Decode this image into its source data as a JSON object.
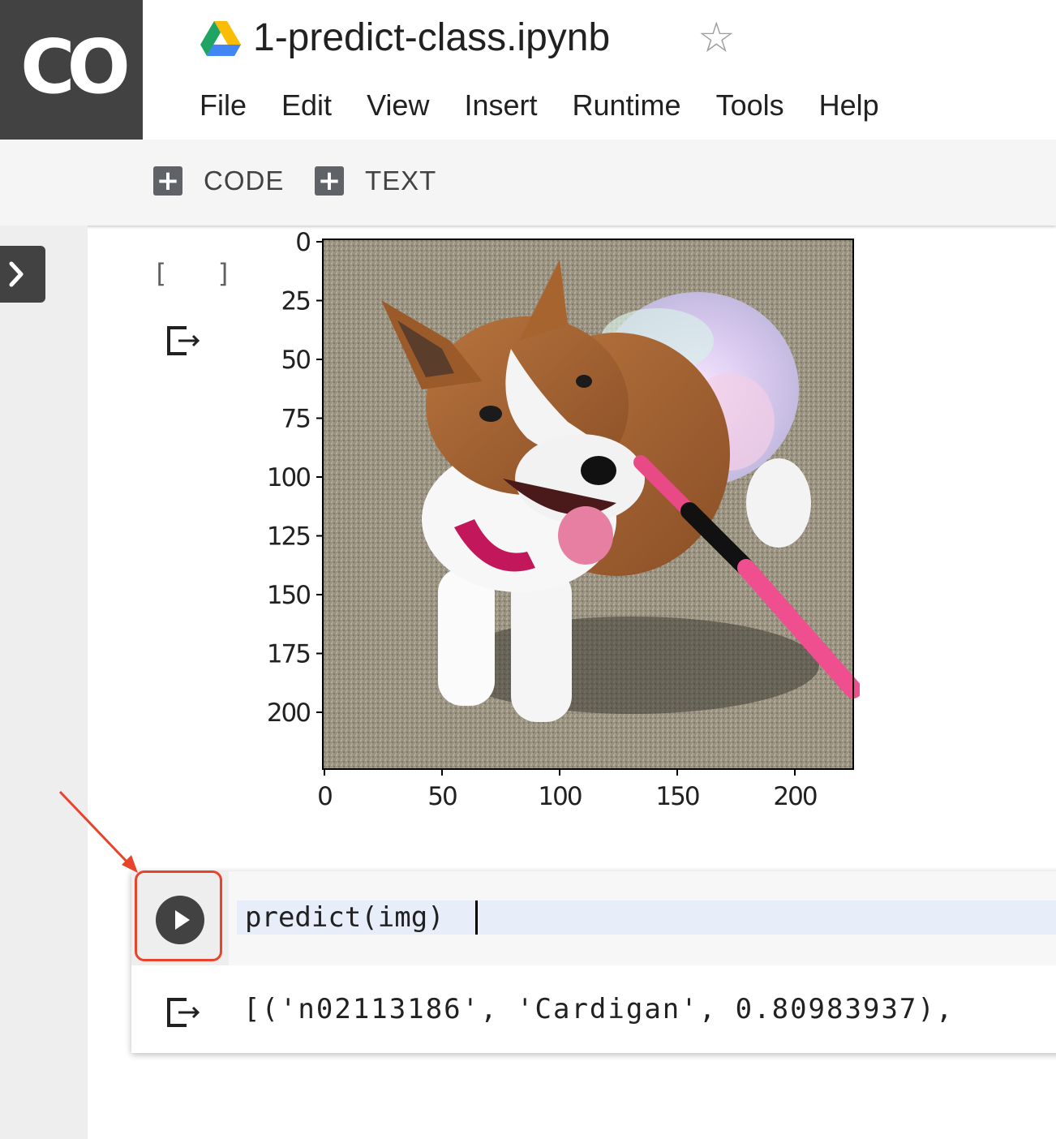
{
  "header": {
    "logo_text": "CO",
    "title": "1-predict-class.ipynb",
    "star_icon": "star-outline-icon",
    "drive_icon": "google-drive-icon"
  },
  "menu": [
    "File",
    "Edit",
    "View",
    "Insert",
    "Runtime",
    "Tools",
    "Help"
  ],
  "toolbar": {
    "code_label": "CODE",
    "text_label": "TEXT"
  },
  "cells": {
    "cell1": {
      "exec_count": "[ ]",
      "plot": {
        "y_ticks": [
          "0",
          "25",
          "50",
          "75",
          "100",
          "125",
          "150",
          "175",
          "200"
        ],
        "x_ticks": [
          "0",
          "50",
          "100",
          "150",
          "200"
        ]
      }
    },
    "cell2": {
      "code": "predict(img)",
      "output": "[('n02113186', 'Cardigan', 0.80983937),"
    }
  },
  "colors": {
    "logo_bg": "#424242",
    "annotation": "#e8442c",
    "code_highlight": "#e8eef9"
  }
}
